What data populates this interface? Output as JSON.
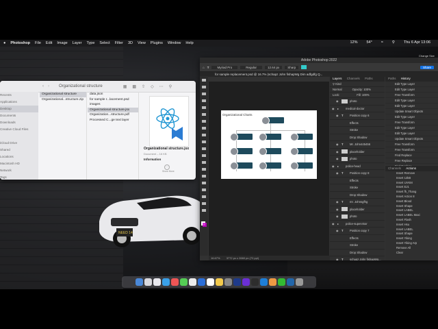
{
  "menubar": {
    "app": "Photoshop",
    "items": [
      "File",
      "Edit",
      "Image",
      "Layer",
      "Type",
      "Select",
      "Filter",
      "3D",
      "View",
      "Plugins",
      "Window",
      "Help"
    ],
    "battery": "12%",
    "cpu": "54°",
    "datetime": "Thu 6 Apr  13:06"
  },
  "change_size_label": "Change Size",
  "finder": {
    "title": "Organizational structure",
    "sidebar": [
      "Recents",
      "Applications",
      "Desktop",
      "Documents",
      "Downloads",
      "Creative Cloud Files",
      "",
      "iCloud Drive",
      "Shared",
      "Locations",
      "Macintosh HD",
      "Network",
      "Tags"
    ],
    "col1": [
      "Organizational structure",
      "Organizational...structure.zip"
    ],
    "col2": [
      "data.json",
      "for sample r...lacement.psd",
      "images",
      "Organizational structure.jsx",
      "Organization...structure.pdf",
      "Processed C...ge text layer"
    ],
    "preview": {
      "name": "Organizational structure.jsx",
      "kind": "Document – 16 KB",
      "info_label": "Information",
      "more_label": "Show More"
    }
  },
  "photoshop": {
    "window_title": "Adobe Photoshop 2022",
    "options": {
      "font": "Myriad Pro",
      "style": "Regular",
      "size": "12.64 px",
      "aa": "Sharp",
      "share": "Share"
    },
    "doc_tab": "for sample replacement.psd @ 16.7% (schapz John fishapWg Dim adfgdfg Q...",
    "zoom": "16.67%",
    "doc_size": "3772 px x 2660 px (72 ppi)",
    "chart_title": "Organizational Charts",
    "layers_tabs": [
      "Layers",
      "Channels",
      "Paths"
    ],
    "layers_kind": "Kind",
    "blend_mode": "Normal",
    "opacity_label": "Opacity:",
    "opacity": "100%",
    "lock_label": "Lock:",
    "fill_label": "Fill:",
    "fill": "100%",
    "layers": [
      {
        "name": "photo",
        "type": "thumb"
      },
      {
        "name": "medical-doctor",
        "type": "folder"
      },
      {
        "name": "Position copy 6",
        "type": "text"
      },
      {
        "name": "Effects",
        "type": "fx"
      },
      {
        "name": "Stroke",
        "type": "fx"
      },
      {
        "name": "Drop Shadow",
        "type": "fx"
      },
      {
        "name": "Mr. John445456",
        "type": "text"
      },
      {
        "name": "placeholder",
        "type": "thumb"
      },
      {
        "name": "photo",
        "type": "thumb"
      },
      {
        "name": "police-head",
        "type": "folder"
      },
      {
        "name": "Position copy 8",
        "type": "text"
      },
      {
        "name": "Effects",
        "type": "fx"
      },
      {
        "name": "Stroke",
        "type": "fx"
      },
      {
        "name": "Drop Shadow",
        "type": "fx"
      },
      {
        "name": "mr. Johnsgfhg",
        "type": "text"
      },
      {
        "name": "placeholder",
        "type": "thumb"
      },
      {
        "name": "photo",
        "type": "thumb"
      },
      {
        "name": "police-supervisor",
        "type": "folder"
      },
      {
        "name": "Position copy 7",
        "type": "text"
      },
      {
        "name": "Effects",
        "type": "fx"
      },
      {
        "name": "Stroke",
        "type": "fx"
      },
      {
        "name": "Drop Shadow",
        "type": "fx"
      },
      {
        "name": "schapz John fishapWg...",
        "type": "text"
      }
    ],
    "history_tabs": [
      "Paths",
      "History"
    ],
    "history": [
      "Edit Type Layer",
      "Edit Type Layer",
      "Free Transform",
      "Edit Type Layer",
      "Edit Type Layer",
      "Update Smart Objects",
      "Edit Type Layer",
      "Free Transform",
      "Edit Type Layer",
      "Edit Type Layer",
      "Update Smart Objects",
      "Free Transform",
      "Free Transform",
      "Find Replace",
      "Free Replace",
      "Find Replace",
      "Find Replace"
    ],
    "actions_tabs": [
      "Channels",
      "Actions"
    ],
    "actions": [
      "Insert Remove",
      "Insert 12kB",
      "Insert UVKM",
      "Insert EJ1",
      "Insert fh_Thang",
      "Insert Action 8",
      "Insert Blood",
      "Insert Shape",
      "Insert LABEL",
      "Insert LABEL Maxi",
      "Insert Flash",
      "Insert Hsu",
      "Insert LABEL",
      "Insert Shape",
      "Insert Yiking",
      "Insert Yiking Arp",
      "Remove All",
      "Clear"
    ]
  }
}
